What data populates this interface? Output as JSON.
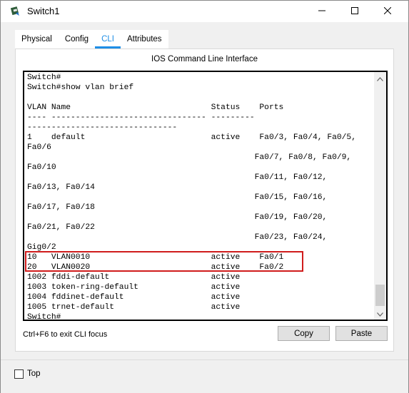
{
  "window": {
    "title": "Switch1",
    "icons": {
      "app": "switch-device-icon",
      "minimize": "minimize-icon",
      "maximize": "maximize-icon",
      "close": "close-icon"
    }
  },
  "tabs": [
    {
      "label": "Physical",
      "active": false
    },
    {
      "label": "Config",
      "active": false
    },
    {
      "label": "CLI",
      "active": true
    },
    {
      "label": "Attributes",
      "active": false
    }
  ],
  "accent_color": "#1e8ee6",
  "highlight_color": "#d01c1c",
  "panel": {
    "heading": "IOS Command Line Interface"
  },
  "cli": {
    "lines": [
      "Switch#",
      "Switch#show vlan brief",
      "",
      "VLAN Name                             Status    Ports",
      "---- -------------------------------- ---------",
      "-------------------------------",
      "1    default                          active    Fa0/3, Fa0/4, Fa0/5,",
      "Fa0/6",
      "                                               Fa0/7, Fa0/8, Fa0/9,",
      "Fa0/10",
      "                                               Fa0/11, Fa0/12,",
      "Fa0/13, Fa0/14",
      "                                               Fa0/15, Fa0/16,",
      "Fa0/17, Fa0/18",
      "                                               Fa0/19, Fa0/20,",
      "Fa0/21, Fa0/22",
      "                                               Fa0/23, Fa0/24,",
      "Gig0/2",
      "10   VLAN0010                         active    Fa0/1",
      "20   VLAN0020                         active    Fa0/2",
      "1002 fddi-default                     active",
      "1003 token-ring-default               active",
      "1004 fddinet-default                  active",
      "1005 trnet-default                    active",
      "Switch#"
    ],
    "highlighted_rows": [
      "10   VLAN0010 active Fa0/1",
      "20   VLAN0020 active Fa0/2"
    ]
  },
  "footer": {
    "hint": "Ctrl+F6 to exit CLI focus",
    "copy_label": "Copy",
    "paste_label": "Paste"
  },
  "bottom": {
    "top_label": "Top",
    "top_checked": false
  }
}
